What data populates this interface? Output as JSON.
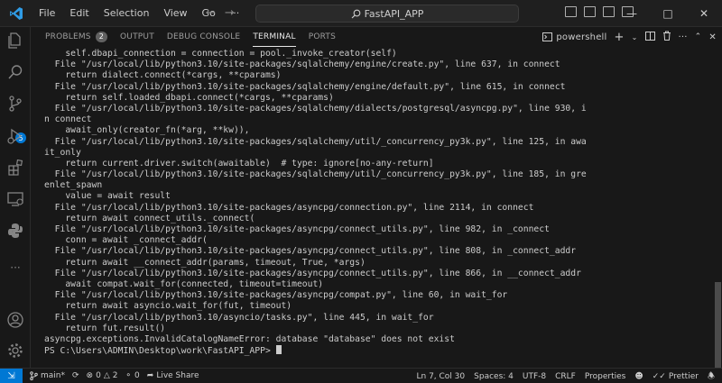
{
  "titlebar": {
    "menu": [
      "File",
      "Edit",
      "Selection",
      "View",
      "Go"
    ],
    "more_label": "···",
    "search_text": "FastAPI_APP"
  },
  "activity": {
    "source_control_badge": "5"
  },
  "panel": {
    "tabs": [
      {
        "label": "PROBLEMS",
        "count": "2"
      },
      {
        "label": "OUTPUT"
      },
      {
        "label": "DEBUG CONSOLE"
      },
      {
        "label": "TERMINAL"
      },
      {
        "label": "PORTS"
      }
    ],
    "active_tab": "TERMINAL",
    "shell_label": "powershell"
  },
  "terminal": {
    "lines": [
      "    self.dbapi_connection = connection = pool._invoke_creator(self)",
      "  File \"/usr/local/lib/python3.10/site-packages/sqlalchemy/engine/create.py\", line 637, in connect",
      "    return dialect.connect(*cargs, **cparams)",
      "  File \"/usr/local/lib/python3.10/site-packages/sqlalchemy/engine/default.py\", line 615, in connect",
      "    return self.loaded_dbapi.connect(*cargs, **cparams)",
      "  File \"/usr/local/lib/python3.10/site-packages/sqlalchemy/dialects/postgresql/asyncpg.py\", line 930, i",
      "n connect",
      "    await_only(creator_fn(*arg, **kw)),",
      "  File \"/usr/local/lib/python3.10/site-packages/sqlalchemy/util/_concurrency_py3k.py\", line 125, in awa",
      "it_only",
      "    return current.driver.switch(awaitable)  # type: ignore[no-any-return]",
      "  File \"/usr/local/lib/python3.10/site-packages/sqlalchemy/util/_concurrency_py3k.py\", line 185, in gre",
      "enlet_spawn",
      "    value = await result",
      "  File \"/usr/local/lib/python3.10/site-packages/asyncpg/connection.py\", line 2114, in connect",
      "    return await connect_utils._connect(",
      "  File \"/usr/local/lib/python3.10/site-packages/asyncpg/connect_utils.py\", line 982, in _connect",
      "    conn = await _connect_addr(",
      "  File \"/usr/local/lib/python3.10/site-packages/asyncpg/connect_utils.py\", line 808, in _connect_addr",
      "    return await __connect_addr(params, timeout, True, *args)",
      "  File \"/usr/local/lib/python3.10/site-packages/asyncpg/connect_utils.py\", line 866, in __connect_addr",
      "    await compat.wait_for(connected, timeout=timeout)",
      "  File \"/usr/local/lib/python3.10/site-packages/asyncpg/compat.py\", line 60, in wait_for",
      "    return await asyncio.wait_for(fut, timeout)",
      "  File \"/usr/local/lib/python3.10/asyncio/tasks.py\", line 445, in wait_for",
      "    return fut.result()",
      "asyncpg.exceptions.InvalidCatalogNameError: database \"database\" does not exist"
    ],
    "prompt": "PS C:\\Users\\ADMIN\\Desktop\\work\\FastAPI_APP> "
  },
  "statusbar": {
    "branch": "main*",
    "errors": "0",
    "warnings": "2",
    "ports": "0",
    "live_share": "Live Share",
    "position": "Ln 7, Col 30",
    "spaces": "Spaces: 4",
    "encoding": "UTF-8",
    "eol": "CRLF",
    "properties": "Properties",
    "prettier": "Prettier"
  },
  "colors": {
    "accent": "#0078d4",
    "background": "#181818"
  }
}
